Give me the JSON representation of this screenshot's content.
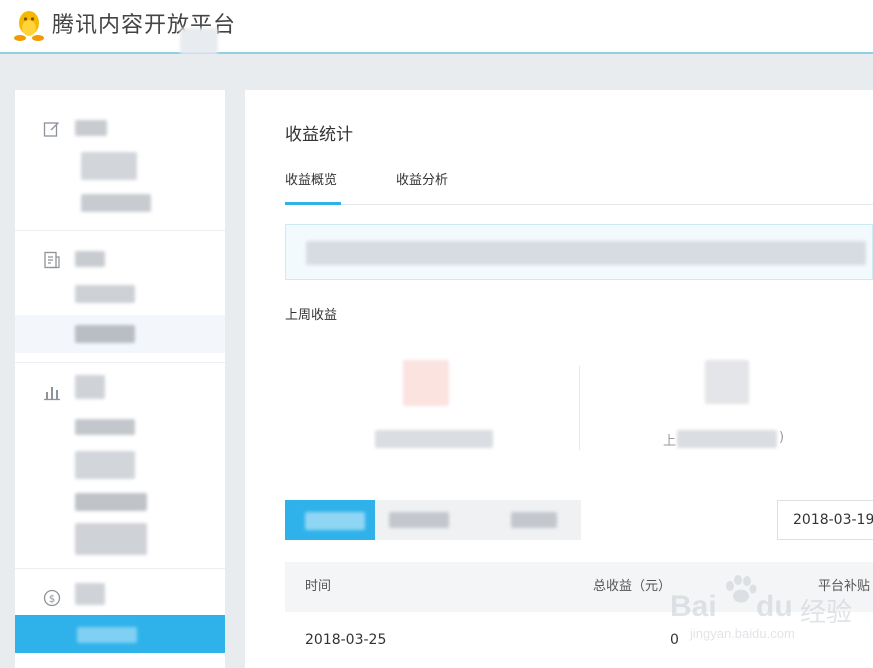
{
  "header": {
    "brand": "腾讯内容开放平台",
    "logo_icon": "penguin-icon"
  },
  "sidebar": {
    "groups": [
      {
        "icon": "edit-icon"
      },
      {
        "icon": "document-icon"
      },
      {
        "icon": "bar-chart-icon"
      },
      {
        "icon": "dollar-circle-icon"
      }
    ]
  },
  "main": {
    "title": "收益统计",
    "tabs": [
      {
        "label": "收益概览",
        "active": true
      },
      {
        "label": "收益分析",
        "active": false
      }
    ],
    "last_week_label": "上周收益",
    "stat_right_prefix": "上",
    "stat_right_suffix": ")",
    "date_value": "2018-03-19",
    "table": {
      "columns": [
        "时间",
        "总收益（元）",
        "平台补贴"
      ],
      "rows": [
        {
          "date": "2018-03-25",
          "total": "0"
        }
      ]
    }
  },
  "watermark": {
    "brand": "Bai",
    "brand2": "du",
    "cn": "经验",
    "url": "jingyan.baidu.com"
  },
  "colors": {
    "accent": "#2fb2ea",
    "header_border": "#8fd0e2",
    "background": "#e9ecef"
  }
}
